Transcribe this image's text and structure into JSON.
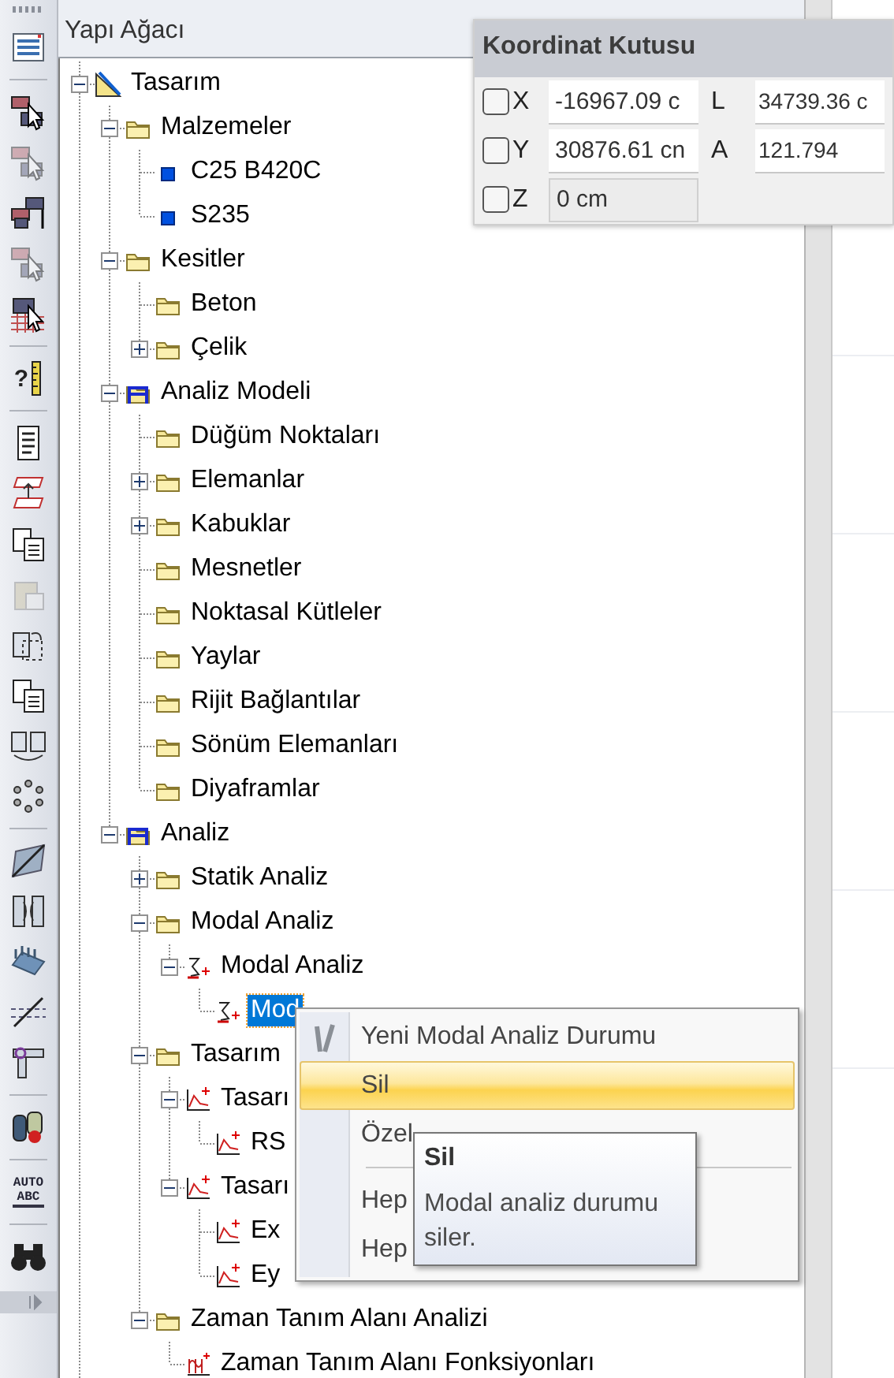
{
  "toolbar": {
    "buttons": [
      {
        "kind": "list",
        "disabled": false
      },
      {
        "kind": "separator"
      },
      {
        "kind": "select",
        "disabled": false
      },
      {
        "kind": "select",
        "disabled": true
      },
      {
        "kind": "select-stack",
        "disabled": false
      },
      {
        "kind": "select",
        "disabled": true
      },
      {
        "kind": "grid-select",
        "disabled": false
      },
      {
        "kind": "separator"
      },
      {
        "kind": "help",
        "label": "?",
        "disabled": false
      },
      {
        "kind": "separator"
      },
      {
        "kind": "document",
        "disabled": false
      },
      {
        "kind": "floors",
        "disabled": false
      },
      {
        "kind": "copy",
        "disabled": false
      },
      {
        "kind": "paste",
        "disabled": true
      },
      {
        "kind": "rotate",
        "disabled": false
      },
      {
        "kind": "copy",
        "disabled": false
      },
      {
        "kind": "mirror",
        "disabled": false
      },
      {
        "kind": "dots",
        "disabled": false
      },
      {
        "kind": "separator"
      },
      {
        "kind": "slash",
        "disabled": false
      },
      {
        "kind": "frame",
        "disabled": false
      },
      {
        "kind": "beam",
        "disabled": false
      },
      {
        "kind": "cut",
        "disabled": false
      },
      {
        "kind": "tee",
        "disabled": false
      },
      {
        "kind": "separator"
      },
      {
        "kind": "cylinders",
        "disabled": false
      },
      {
        "kind": "separator"
      },
      {
        "kind": "auto",
        "labels": [
          "AUTO",
          "ABC"
        ],
        "disabled": false
      },
      {
        "kind": "separator"
      },
      {
        "kind": "binoculars",
        "disabled": false
      }
    ]
  },
  "panel": {
    "title": "Yapı Ağacı"
  },
  "tree": [
    {
      "label": "Tasarım",
      "kind": "design",
      "expanded": true,
      "selected": false,
      "children": [
        {
          "label": "Malzemeler",
          "kind": "folder",
          "expanded": true,
          "selected": false,
          "children": [
            {
              "label": "C25 B420C",
              "kind": "material",
              "selected": false
            },
            {
              "label": "S235",
              "kind": "material",
              "selected": false
            }
          ]
        },
        {
          "label": "Kesitler",
          "kind": "folder",
          "expanded": true,
          "selected": false,
          "children": [
            {
              "label": "Beton",
              "kind": "folder",
              "selected": false
            },
            {
              "label": "Çelik",
              "kind": "folder",
              "expanded": false,
              "selected": false
            }
          ]
        },
        {
          "label": "Analiz Modeli",
          "kind": "frame",
          "expanded": true,
          "selected": false,
          "children": [
            {
              "label": "Düğüm Noktaları",
              "kind": "folder",
              "selected": false
            },
            {
              "label": "Elemanlar",
              "kind": "folder",
              "expanded": false,
              "selected": false
            },
            {
              "label": "Kabuklar",
              "kind": "folder",
              "expanded": false,
              "selected": false
            },
            {
              "label": "Mesnetler",
              "kind": "folder",
              "selected": false
            },
            {
              "label": "Noktasal Kütleler",
              "kind": "folder",
              "selected": false
            },
            {
              "label": "Yaylar",
              "kind": "folder",
              "selected": false
            },
            {
              "label": "Rijit Bağlantılar",
              "kind": "folder",
              "selected": false
            },
            {
              "label": "Sönüm Elemanları",
              "kind": "folder",
              "selected": false
            },
            {
              "label": "Diyaframlar",
              "kind": "folder",
              "selected": false
            }
          ]
        },
        {
          "label": "Analiz",
          "kind": "frame",
          "expanded": true,
          "selected": false,
          "children": [
            {
              "label": "Statik Analiz",
              "kind": "folder",
              "expanded": false,
              "selected": false
            },
            {
              "label": "Modal Analiz",
              "kind": "folder",
              "expanded": true,
              "selected": false,
              "children": [
                {
                  "label": "Modal Analiz",
                  "kind": "modal",
                  "expanded": true,
                  "selected": false,
                  "children": [
                    {
                      "label": "Mod",
                      "kind": "modal",
                      "selected": true
                    }
                  ]
                }
              ]
            },
            {
              "label": "Tasarım",
              "kind": "folder",
              "expanded": true,
              "selected": false,
              "children": [
                {
                  "label": "Tasarı",
                  "kind": "spectrum",
                  "expanded": true,
                  "selected": false,
                  "children": [
                    {
                      "label": "RS",
                      "kind": "spectrum",
                      "selected": false
                    }
                  ]
                },
                {
                  "label": "Tasarı",
                  "kind": "spectrum",
                  "expanded": true,
                  "selected": false,
                  "children": [
                    {
                      "label": "Ex",
                      "kind": "spectrum",
                      "selected": false
                    },
                    {
                      "label": "Ey",
                      "kind": "spectrum",
                      "selected": false
                    }
                  ]
                }
              ]
            },
            {
              "label": "Zaman Tanım Alanı Analizi",
              "kind": "folder",
              "expanded": true,
              "selected": false,
              "children": [
                {
                  "label": "Zaman Tanım Alanı Fonksiyonları",
                  "kind": "history",
                  "selected": false
                }
              ]
            }
          ]
        }
      ]
    }
  ],
  "coordinate_box": {
    "title": "Koordinat Kutusu",
    "rows": [
      {
        "axis": "X",
        "checked": false,
        "value": "-16967.09 c",
        "disabled": false,
        "extra_label": "L",
        "extra_value": "34739.36 c"
      },
      {
        "axis": "Y",
        "checked": false,
        "value": "30876.61 cn",
        "disabled": false,
        "extra_label": "A",
        "extra_value": "121.794"
      },
      {
        "axis": "Z",
        "checked": false,
        "value": "0 cm",
        "disabled": true
      }
    ]
  },
  "context_menu": {
    "items": [
      {
        "kind": "item",
        "label": "Yeni Modal Analiz Durumu",
        "icon": true,
        "selected": false
      },
      {
        "kind": "item",
        "label": "Sil",
        "selected": true
      },
      {
        "kind": "item",
        "label": "Özel",
        "selected": false
      },
      {
        "kind": "separator"
      },
      {
        "kind": "item",
        "label": "Hep",
        "selected": false
      },
      {
        "kind": "item",
        "label": "Hep",
        "selected": false
      }
    ]
  },
  "tooltip": {
    "title": "Sil",
    "text": "Modal analiz durumu siler."
  }
}
